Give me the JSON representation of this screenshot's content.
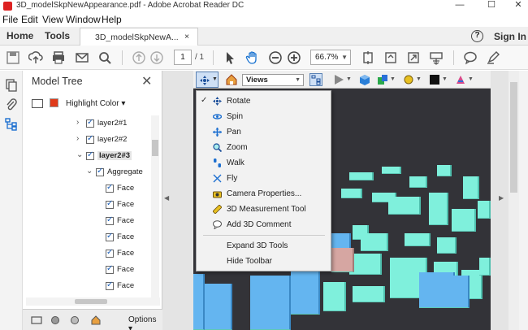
{
  "window": {
    "title": "3D_modelSkpNewAppearance.pdf - Adobe Acrobat Reader DC",
    "minimize_glyph": "—",
    "maximize_glyph": "☐",
    "close_glyph": "✕"
  },
  "menubar": {
    "items": [
      "File",
      "Edit",
      "View",
      "Window",
      "Help"
    ]
  },
  "tabs": {
    "home": "Home",
    "tools": "Tools",
    "document": "3D_modelSkpNewA...",
    "close_glyph": "×"
  },
  "header": {
    "help_glyph": "?",
    "sign_in": "Sign In"
  },
  "toolbar": {
    "page_current": "1",
    "page_total": "/ 1",
    "zoom": "66.7%",
    "icons": [
      "save-icon",
      "upload-icon",
      "print-icon",
      "email-icon",
      "search-icon",
      "page-up-icon",
      "page-down-icon",
      "cursor-icon",
      "hand-icon",
      "zoom-out-icon",
      "zoom-in-icon",
      "fit-page-icon",
      "scroll-mode-icon",
      "full-screen-icon",
      "read-mode-icon",
      "comment-icon",
      "highlight-pen-icon"
    ]
  },
  "model_tree": {
    "title": "Model Tree",
    "close_glyph": "✕",
    "highlight_label": "Highlight Color ▾",
    "highlight_color": "#e03a1a",
    "nodes": [
      {
        "label": "layer2#1",
        "twisty": "›",
        "selected": false
      },
      {
        "label": "layer2#2",
        "twisty": "›",
        "selected": false
      },
      {
        "label": "layer2#3",
        "twisty": "⌄",
        "selected": true
      },
      {
        "label": "Aggregate",
        "twisty": "⌄",
        "selected": false
      },
      {
        "label": "Face",
        "twisty": "",
        "selected": false
      },
      {
        "label": "Face",
        "twisty": "",
        "selected": false
      },
      {
        "label": "Face",
        "twisty": "",
        "selected": false
      },
      {
        "label": "Face",
        "twisty": "",
        "selected": false
      },
      {
        "label": "Face",
        "twisty": "",
        "selected": false
      },
      {
        "label": "Face",
        "twisty": "",
        "selected": false
      },
      {
        "label": "Face",
        "twisty": "",
        "selected": false
      }
    ],
    "options": "Options ▾"
  },
  "tb3d": {
    "views": "Views"
  },
  "menu3d": {
    "items": [
      {
        "label": "Rotate",
        "checked": true,
        "icon": "rotate-icon"
      },
      {
        "label": "Spin",
        "checked": false,
        "icon": "spin-icon"
      },
      {
        "label": "Pan",
        "checked": false,
        "icon": "pan-icon"
      },
      {
        "label": "Zoom",
        "checked": false,
        "icon": "zoom-icon"
      },
      {
        "label": "Walk",
        "checked": false,
        "icon": "walk-icon"
      },
      {
        "label": "Fly",
        "checked": false,
        "icon": "fly-icon"
      },
      {
        "label": "Camera Properties...",
        "checked": false,
        "icon": "camera-icon"
      },
      {
        "label": "3D Measurement Tool",
        "checked": false,
        "icon": "ruler-icon"
      },
      {
        "label": "Add 3D Comment",
        "checked": false,
        "icon": "comment-3d-icon"
      },
      {
        "label": "Expand 3D Tools",
        "checked": false,
        "icon": ""
      },
      {
        "label": "Hide Toolbar",
        "checked": false,
        "icon": ""
      }
    ]
  }
}
